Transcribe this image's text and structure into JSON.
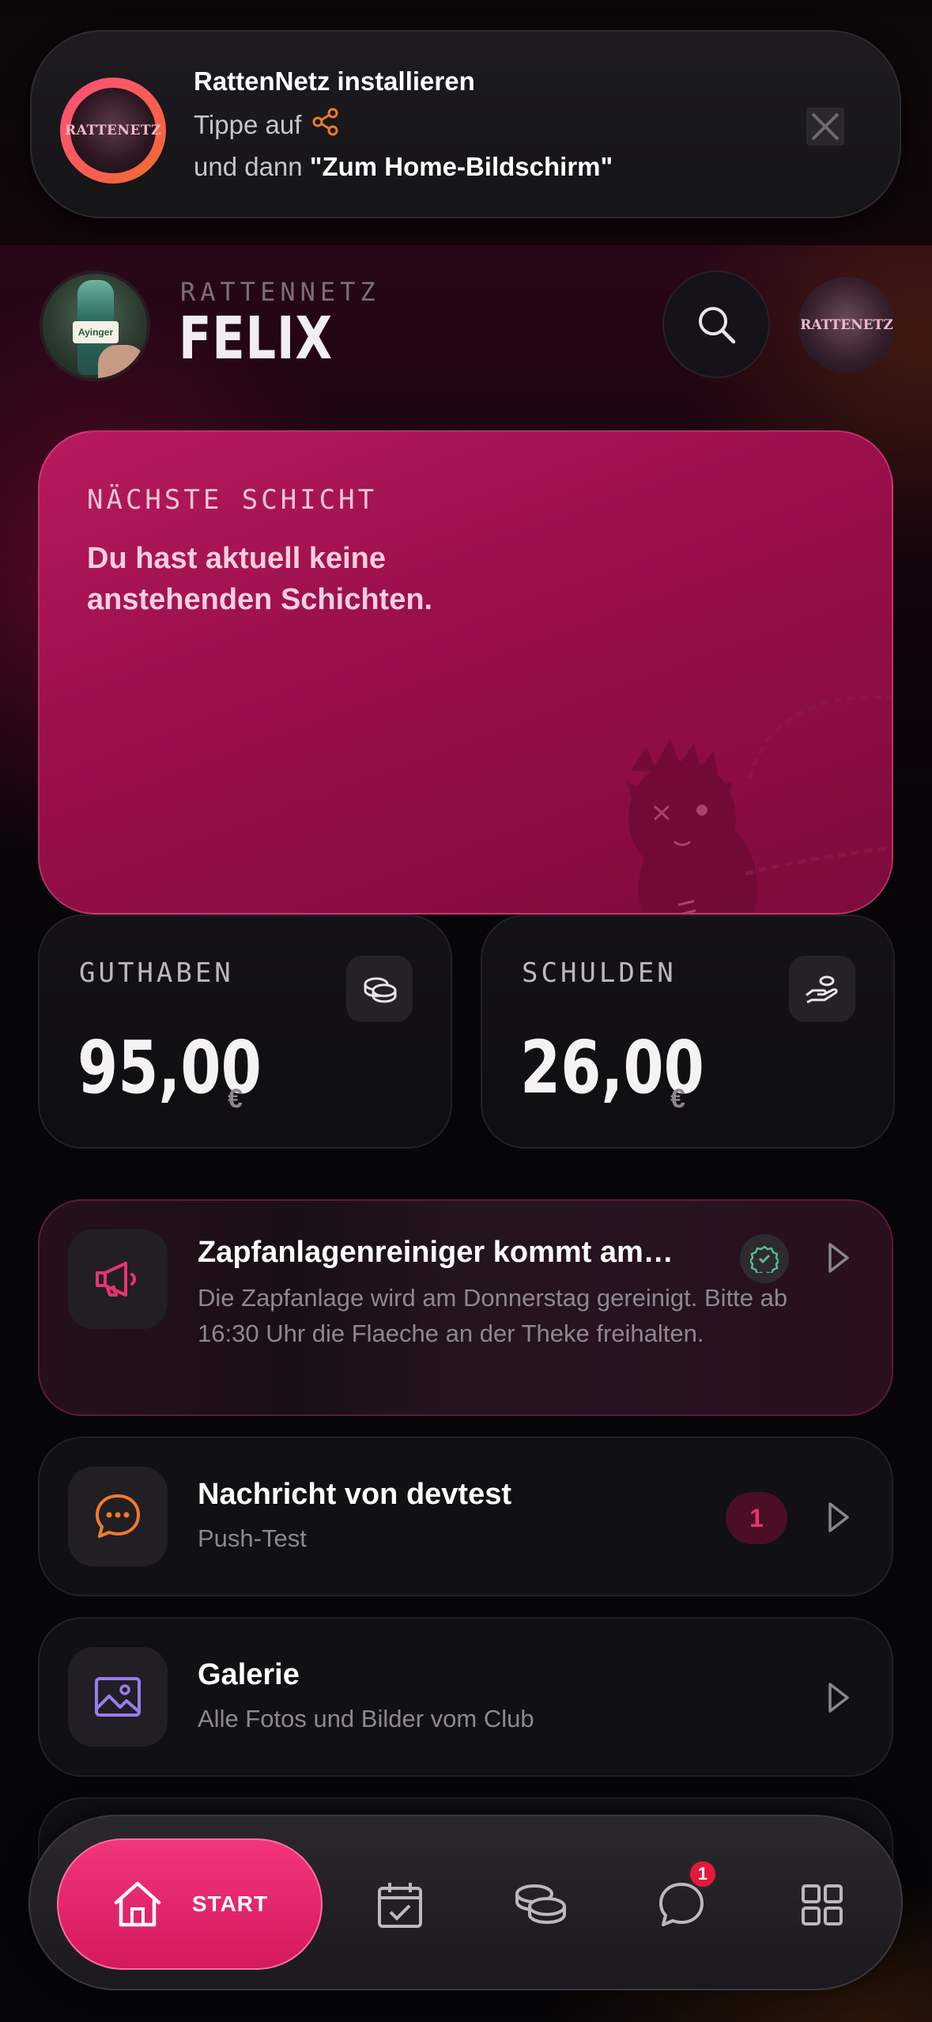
{
  "banner": {
    "title": "RattenNetz installieren",
    "line1_prefix": "Tippe auf",
    "line2_prefix": "und dann",
    "line2_target": "\"Zum Home-Bildschirm\"",
    "logo_text": "RATTENETZ"
  },
  "header": {
    "brand": "RATTENNETZ",
    "user_name": "FELIX",
    "avatar_label": "Ayinger",
    "club_logo_text": "RATTENETZ"
  },
  "shift": {
    "label": "NÄCHSTE SCHICHT",
    "text": "Du hast aktuell keine anstehenden Schichten."
  },
  "balances": {
    "credit": {
      "label": "GUTHABEN",
      "value": "95,00",
      "currency": "€"
    },
    "debt": {
      "label": "SCHULDEN",
      "value": "26,00",
      "currency": "€"
    }
  },
  "items": {
    "news": {
      "title": "Zapfanlagenreiniger kommt am…",
      "subtitle": "Die Zapfanlage wird am Donnerstag gereinigt. Bitte ab 16:30 Uhr die Flaeche an der Theke freihalten."
    },
    "message": {
      "title": "Nachricht von devtest",
      "subtitle": "Push-Test",
      "count": "1"
    },
    "gallery": {
      "title": "Galerie",
      "subtitle": "Alle Fotos und Bilder vom Club"
    }
  },
  "nav": {
    "home_label": "START",
    "chat_badge": "1",
    "items": [
      "home",
      "calendar",
      "coins",
      "chat",
      "grid"
    ]
  },
  "colors": {
    "accent": "#e8336e",
    "card_pink": "#a3114f",
    "share_orange": "#f07a2c"
  }
}
